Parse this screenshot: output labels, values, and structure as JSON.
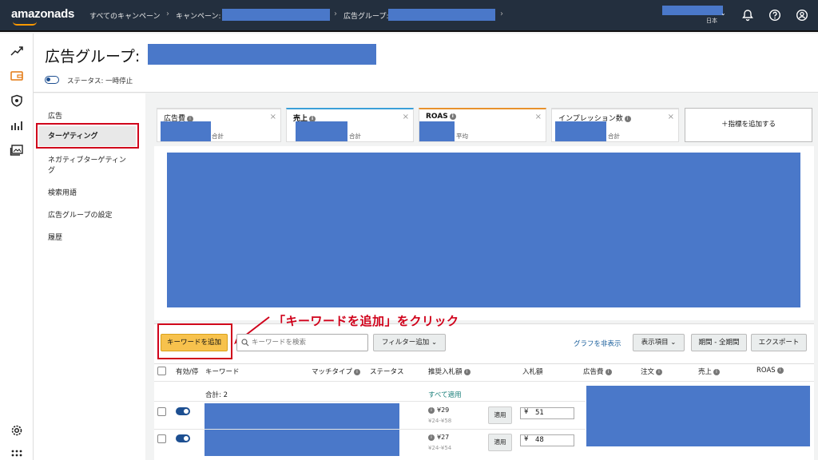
{
  "topbar": {
    "logo": "amazonads",
    "crumbs": [
      "すべてのキャンペーン",
      "キャンペーン:",
      "広告グループ:"
    ],
    "region": "日本"
  },
  "header": {
    "title": "広告グループ:",
    "status": "ステータス: 一時停止"
  },
  "nav": {
    "items": [
      "広告",
      "ターゲティング",
      "ネガティブターゲティング",
      "検索用語",
      "広告グループの設定",
      "履歴"
    ]
  },
  "metrics": [
    {
      "label": "広告費",
      "sub": "合計",
      "accent": "#dddddd"
    },
    {
      "label": "売上",
      "sub": "合計",
      "accent": "#3b9fd8"
    },
    {
      "label": "ROAS",
      "sub": "平均",
      "accent": "#e8922d"
    },
    {
      "label": "インプレッション数",
      "sub": "合計",
      "accent": "#dddddd"
    }
  ],
  "add_metric": "＋指標を追加する",
  "annotation": "「キーワードを追加」をクリック",
  "toolbar": {
    "add_keyword": "キーワードを追加",
    "search_placeholder": "キーワードを検索",
    "add_filter": "フィルター追加",
    "hide_graph": "グラフを非表示",
    "columns": "表示項目",
    "period": "期間 - 全期間",
    "export": "エクスポート"
  },
  "table": {
    "headers": [
      "有効/停",
      "キーワード",
      "マッチタイプ",
      "ステータス",
      "推奨入札額",
      "入札額",
      "広告費",
      "注文",
      "売上",
      "ROAS"
    ],
    "total_label": "合計: 2",
    "apply_all": "すべて適用",
    "rows": [
      {
        "suggested": "¥29",
        "range": "¥24-¥58",
        "apply": "適用",
        "bid": "51"
      },
      {
        "suggested": "¥27",
        "range": "¥24-¥54",
        "apply": "適用",
        "bid": "48"
      }
    ],
    "currency": "¥"
  },
  "colors": {
    "topbar": "#232f3e",
    "accent_orange": "#ff9900",
    "button_yellow": "#f7c24d",
    "highlight_red": "#d0021b",
    "redaction_blue": "#4a78c9"
  }
}
